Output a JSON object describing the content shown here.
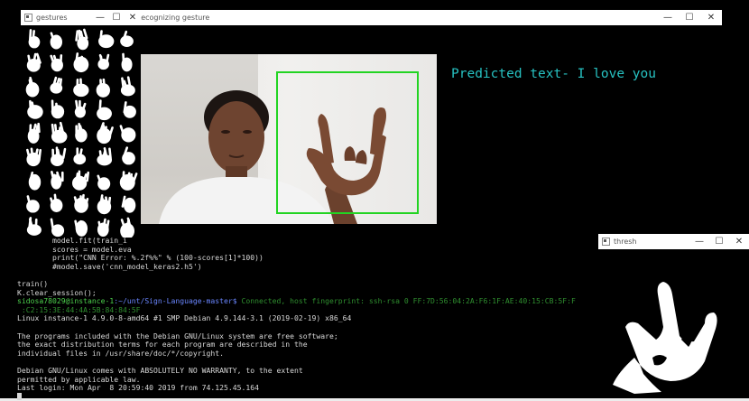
{
  "terminal": {
    "lines_top": [
      "        model.fit(train_i",
      "        scores = model.eva",
      "        print(\"CNN Error: %.2f%%\" % (100-scores[1]*100))",
      "        #model.save('cnn_model_keras2.h5')",
      "",
      "train()",
      "K.clear_session();"
    ],
    "prompt_user": "sidosa78029@instance-1",
    "prompt_path": ":~/unt/Sign-Language-master$",
    "prompt_status": " Connected, host fingerprint: ssh-rsa 0 FF:7D:56:04:2A:F6:1F:AE:40:15:CB:5F:F",
    "fingerprint_tail": " :C2:15:3E:44:4A:5B:84:84:5F",
    "lines_bottom": [
      "Linux instance-1 4.9.0-8-amd64 #1 SMP Debian 4.9.144-3.1 (2019-02-19) x86_64",
      "",
      "The programs included with the Debian GNU/Linux system are free software;",
      "the exact distribution terms for each program are described in the",
      "individual files in /usr/share/doc/*/copyright.",
      "",
      "Debian GNU/Linux comes with ABSOLUTELY NO WARRANTY, to the extent",
      "permitted by applicable law.",
      "Last login: Mon Apr  8 20:59:40 2019 from 74.125.45.164"
    ]
  },
  "windows": {
    "recognizing": {
      "title": "Recognizing gesture",
      "predicted_text": "Predicted text- I love you"
    },
    "gestures": {
      "title": "gestures"
    },
    "thresh": {
      "title": "thresh"
    }
  },
  "controls": {
    "minimize": "—",
    "maximize": "☐",
    "close": "✕"
  },
  "colors": {
    "prediction": "#27c2c2",
    "detection_box": "#22d422",
    "terminal_prompt": "#4dd14d",
    "terminal_path": "#6a86ff"
  },
  "icons": {
    "window_icon": "app-window-icon"
  }
}
